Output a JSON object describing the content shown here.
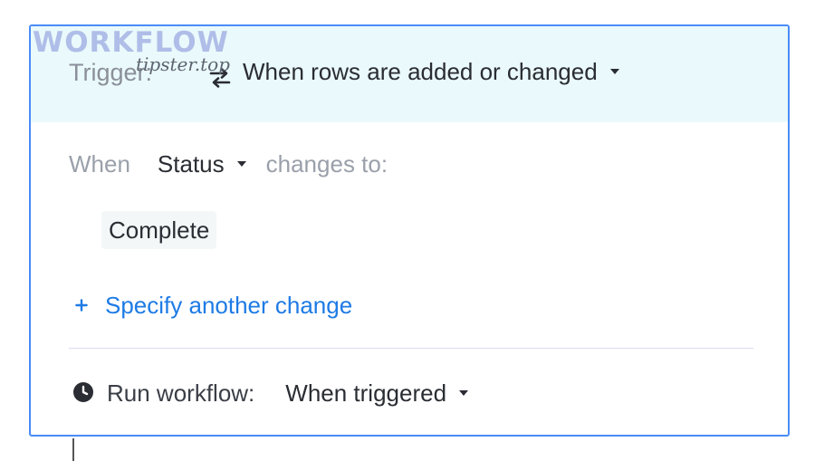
{
  "watermark": {
    "title": "WORKFLOW",
    "subtitle": "tipster.top"
  },
  "trigger": {
    "label": "Trigger:",
    "icon": "swap-arrows-icon",
    "value": "When rows are added or changed"
  },
  "condition": {
    "when_label": "When",
    "column": "Status",
    "changes_label": "changes to:",
    "value": "Complete"
  },
  "add_change": {
    "icon": "plus-icon",
    "label": "Specify another change"
  },
  "run": {
    "icon": "clock-icon",
    "label": "Run workflow:",
    "value": "When triggered"
  },
  "colors": {
    "accent": "#1e7be5",
    "border": "#4a8cf7",
    "header_bg": "#eaf9fb"
  }
}
